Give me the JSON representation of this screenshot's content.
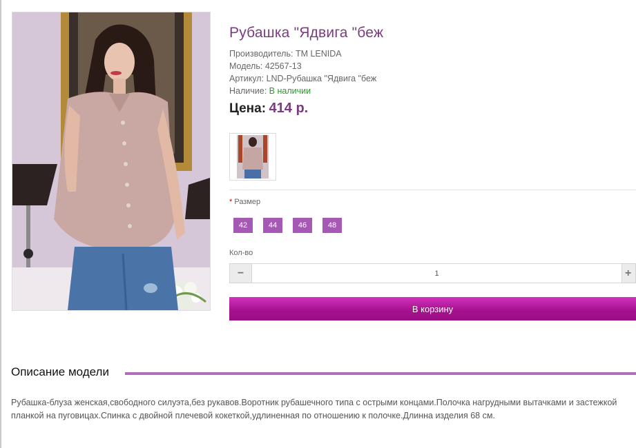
{
  "product": {
    "title": "Рубашка \"Ядвига \"беж",
    "manufacturer_label": "Производитель:",
    "manufacturer": "TM LENIDA",
    "model_label": "Модель:",
    "model": "42567-13",
    "sku_label": "Артикул:",
    "sku": "LND-Рубашка \"Ядвига \"беж",
    "availability_label": "Наличие:",
    "availability": "В наличии",
    "price_label": "Цена:",
    "price": "414 р."
  },
  "options": {
    "size_label": "Размер",
    "required_mark": "*",
    "sizes": [
      "42",
      "44",
      "46",
      "48"
    ]
  },
  "quantity": {
    "label": "Кол-во",
    "value": "1",
    "minus": "−",
    "plus": "+"
  },
  "cart": {
    "button_label": "В корзину"
  },
  "description": {
    "heading": "Описание модели",
    "text": "Рубашка-блуза женская,свободного силуэта,без рукавов.Воротник рубашечного типа с острыми концами.Полочка нагрудными вытачками и застежкой планкой на пуговицах.Спинка с двойной плечевой кокеткой,удлиненная по отношению к полочке.Длинна изделия 68 см."
  },
  "colors": {
    "accent": "#7a3b7f",
    "size_button": "#a559b4",
    "cart_button": "#b81fa0",
    "in_stock": "#2a9a2a"
  }
}
